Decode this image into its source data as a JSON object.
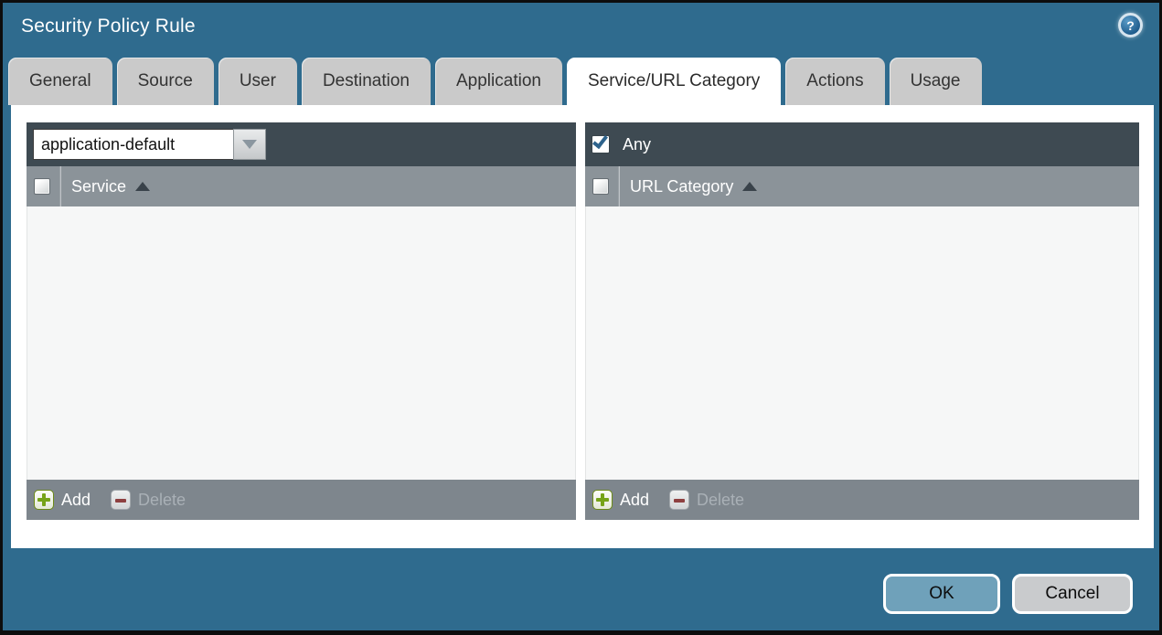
{
  "dialog": {
    "title": "Security Policy Rule"
  },
  "help": {
    "glyph": "?"
  },
  "tabs": [
    {
      "label": "General",
      "active": false
    },
    {
      "label": "Source",
      "active": false
    },
    {
      "label": "User",
      "active": false
    },
    {
      "label": "Destination",
      "active": false
    },
    {
      "label": "Application",
      "active": false
    },
    {
      "label": "Service/URL Category",
      "active": true
    },
    {
      "label": "Actions",
      "active": false
    },
    {
      "label": "Usage",
      "active": false
    }
  ],
  "service_panel": {
    "dropdown": {
      "value": "application-default"
    },
    "select_all_checked": false,
    "column_header": "Service",
    "sort_indicator": "ascending",
    "rows": [],
    "add_label": "Add",
    "delete_label": "Delete",
    "delete_enabled": false
  },
  "url_category_panel": {
    "any_checkbox": {
      "label": "Any",
      "checked": true
    },
    "select_all_checked": false,
    "column_header": "URL Category",
    "sort_indicator": "ascending",
    "rows": [],
    "add_label": "Add",
    "delete_label": "Delete",
    "delete_enabled": false
  },
  "footer_buttons": {
    "ok": "OK",
    "cancel": "Cancel"
  },
  "colors": {
    "dialog_background": "#2f6b8e",
    "toolbar_dark": "#3e4a52",
    "header_gray": "#8b9399",
    "footer_gray": "#7e868d",
    "body_light": "#f6f7f7",
    "tab_inactive": "#cacaca",
    "tab_active": "#ffffff",
    "ok_button": "#6fa1ba",
    "cancel_button": "#c9cbcd",
    "add_green": "#76a318",
    "delete_red": "#8e4040",
    "check_blue": "#2e638c"
  }
}
